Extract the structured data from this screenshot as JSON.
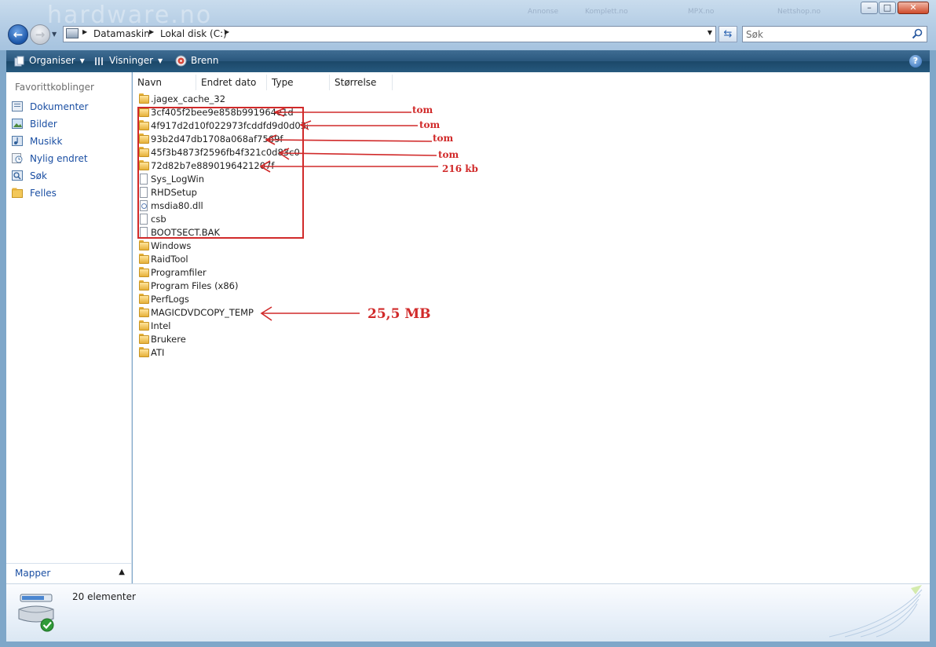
{
  "window": {
    "watermark_text": "hardware.no",
    "watermark_links": [
      "Annonse",
      "Komplett.no",
      "MPX.no",
      "Nettshop.no"
    ],
    "caption_buttons": [
      "minimize",
      "maximize",
      "close"
    ]
  },
  "nav": {
    "back_icon": "back-arrow-icon",
    "forward_icon": "forward-arrow-icon",
    "breadcrumb": [
      "Datamaskin",
      "Lokal disk (C:)"
    ],
    "search_placeholder": "Søk"
  },
  "toolbar": {
    "organize_label": "Organiser",
    "views_label": "Visninger",
    "burn_label": "Brenn",
    "help_label": "?"
  },
  "sidebar": {
    "heading": "Favorittkoblinger",
    "items": [
      {
        "label": "Dokumenter",
        "icon": "documents-icon"
      },
      {
        "label": "Bilder",
        "icon": "pictures-icon"
      },
      {
        "label": "Musikk",
        "icon": "music-icon"
      },
      {
        "label": "Nylig endret",
        "icon": "recently-changed-icon"
      },
      {
        "label": "Søk",
        "icon": "search-folder-icon"
      },
      {
        "label": "Felles",
        "icon": "public-folder-icon"
      }
    ],
    "folders_label": "Mapper"
  },
  "columns": [
    "Navn",
    "Endret dato",
    "Type",
    "Størrelse"
  ],
  "files": [
    {
      "name": ".jagex_cache_32",
      "kind": "folder"
    },
    {
      "name": "3cf405f2bee9e858b991964e1d",
      "kind": "folder"
    },
    {
      "name": "4f917d2d10f022973fcddfd9d0d03af3",
      "kind": "folder"
    },
    {
      "name": "93b2d47db1708a068af7569f",
      "kind": "folder"
    },
    {
      "name": "45f3b4873f2596fb4f321c0d83c0",
      "kind": "folder"
    },
    {
      "name": "72d82b7e8890196421207f",
      "kind": "folder"
    },
    {
      "name": "Sys_LogWin",
      "kind": "file"
    },
    {
      "name": "RHDSetup",
      "kind": "file"
    },
    {
      "name": "msdia80.dll",
      "kind": "dll"
    },
    {
      "name": "csb",
      "kind": "file"
    },
    {
      "name": "BOOTSECT.BAK",
      "kind": "file"
    },
    {
      "name": "Windows",
      "kind": "folder"
    },
    {
      "name": "RaidTool",
      "kind": "folder"
    },
    {
      "name": "Programfiler",
      "kind": "folder"
    },
    {
      "name": "Program Files (x86)",
      "kind": "folder"
    },
    {
      "name": "PerfLogs",
      "kind": "folder"
    },
    {
      "name": "MAGICDVDCOPY_TEMP",
      "kind": "folder"
    },
    {
      "name": "Intel",
      "kind": "folder"
    },
    {
      "name": "Brukere",
      "kind": "folder"
    },
    {
      "name": "ATI",
      "kind": "folder"
    }
  ],
  "annotations": [
    {
      "text": "tom"
    },
    {
      "text": "tom"
    },
    {
      "text": "tom"
    },
    {
      "text": "tom"
    },
    {
      "text": "216 kb"
    },
    {
      "text": "25,5 MB"
    }
  ],
  "annotation_color": "#d12a2a",
  "details": {
    "item_count": "20 elementer",
    "icon": "drive-icon"
  }
}
